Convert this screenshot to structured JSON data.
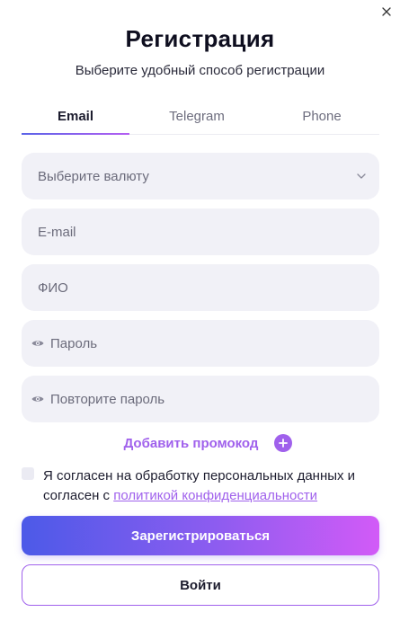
{
  "title": "Регистрация",
  "subtitle": "Выберите удобный способ регистрации",
  "tabs": [
    {
      "label": "Email",
      "active": true
    },
    {
      "label": "Telegram",
      "active": false
    },
    {
      "label": "Phone",
      "active": false
    }
  ],
  "fields": {
    "currency": {
      "placeholder": "Выберите валюту",
      "icon": "chevron-down-icon"
    },
    "email": {
      "placeholder": "E-mail"
    },
    "full_name": {
      "placeholder": "ФИО"
    },
    "password": {
      "placeholder": "Пароль",
      "icon": "eye-icon"
    },
    "password_repeat": {
      "placeholder": "Повторите пароль",
      "icon": "eye-icon"
    }
  },
  "promo": {
    "label": "Добавить промокод",
    "icon": "plus-icon"
  },
  "consent": {
    "text": "Я согласен на обработку персональных данных и согласен с ",
    "link": "политикой конфиденциальности",
    "checked": false
  },
  "buttons": {
    "register": "Зарегистрироваться",
    "login": "Войти"
  },
  "colors": {
    "accent": "#a061ec",
    "gradient_start": "#4c5ae8",
    "gradient_end": "#d25bf7",
    "field_bg": "#f1f1f7"
  }
}
